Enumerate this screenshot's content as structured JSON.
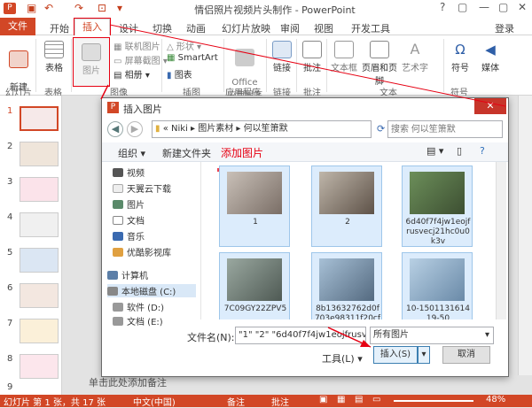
{
  "app": {
    "window_title": "情侣照片视频片头制作 - PowerPoint",
    "login": "登录",
    "help": "?"
  },
  "tabs": [
    "文件",
    "开始",
    "插入",
    "设计",
    "切换",
    "动画",
    "幻灯片放映",
    "审阅",
    "视图",
    "开发工具"
  ],
  "ribbon": {
    "new_slide": "新建\n幻灯片",
    "table": "表格",
    "picture": "图片",
    "online_pictures": "联机图片",
    "screenshot": "屏幕截图",
    "album": "相册",
    "shapes": "形状",
    "smartart": "SmartArt",
    "chart": "图表",
    "office_apps": "Office\n应用程序",
    "link": "链接",
    "comment": "批注",
    "textbox": "文本框",
    "header_footer": "页眉和页脚",
    "wordart": "艺术字",
    "symbol": "符号",
    "media": "媒体",
    "groups": [
      "幻灯片",
      "表格",
      "图像",
      "插图",
      "应用程序",
      "链接",
      "批注",
      "文本",
      "符号"
    ]
  },
  "thumbnails": [
    "1",
    "2",
    "3",
    "4",
    "5",
    "6",
    "7",
    "8",
    "9"
  ],
  "notes_placeholder": "单击此处添加备注",
  "status": {
    "slide": "幻灯片 第 1 张，共 17 张",
    "lang": "中文(中国)",
    "notes": "备注",
    "comments": "批注",
    "zoom": "48%"
  },
  "dialog": {
    "title": "插入图片",
    "breadcrumb": [
      "«",
      "Niki",
      "图片素材",
      "何以笙箫默"
    ],
    "search_placeholder": "搜索 何以笙箫默",
    "organize": "组织 ▾",
    "new_folder": "新建文件夹",
    "annotation": "添加图片",
    "nav": [
      "视频",
      "天翼云下载",
      "图片",
      "文档",
      "音乐",
      "优酷影视库",
      "计算机",
      "本地磁盘 (C:)",
      "软件 (D:)",
      "文档 (E:)"
    ],
    "files": [
      "1",
      "2",
      "6d40f7f4jw1eojfrusvecj21hc0u0k3v",
      "7C09GY22ZPV5",
      "8b13632762d0f703e98311f20cf",
      "10-150113161419-50"
    ],
    "filename_label": "文件名(N):",
    "filename_value": "\"1\" \"2\" \"6d40f7f4jw1eojfrusvec",
    "filetype": "所有图片",
    "tools": "工具(L)",
    "insert": "插入(S)",
    "cancel": "取消"
  },
  "colors": {
    "accent": "#d24726",
    "annotation": "#e60012",
    "selection": "#dcecfc"
  }
}
